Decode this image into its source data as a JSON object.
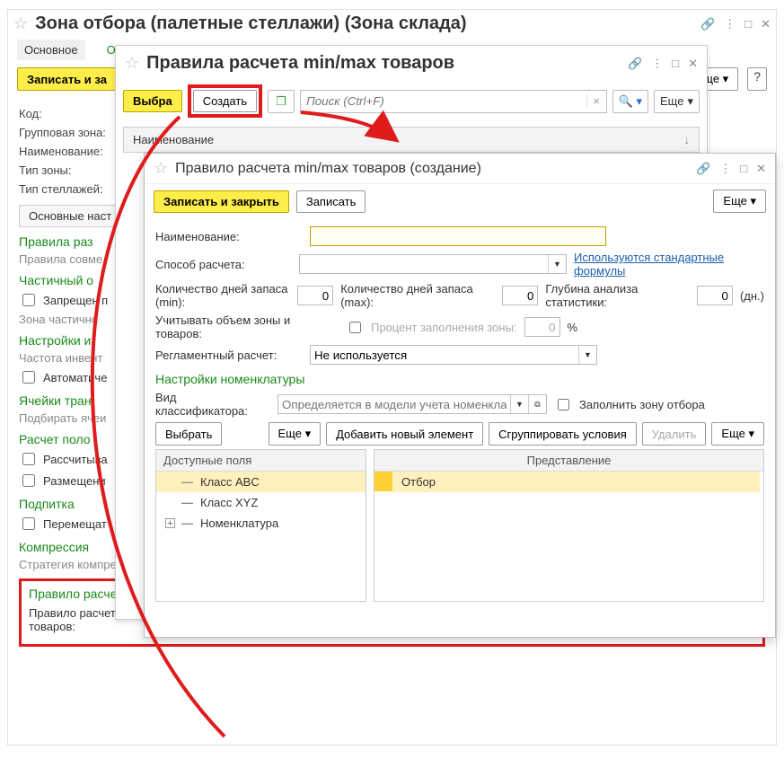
{
  "win1": {
    "title": "Зона отбора (палетные стеллажи) (Зона склада)",
    "tabs": {
      "main": "Основное",
      "other": "Ос"
    },
    "toolbar": {
      "save_close": "Записать и за",
      "more_tail": "ще",
      "help": "?"
    },
    "labels": {
      "code": "Код:",
      "group_zone": "Групповая зона:",
      "name": "Наименование:",
      "zone_type": "Тип зоны:",
      "rack_type": "Тип стеллажей:"
    },
    "settings_tab": "Основные наст",
    "sections": {
      "placement_rules": "Правила раз",
      "compat_rules": "Правила совме",
      "partial": "Частичный о",
      "partial_block": "Запрещен п",
      "partial_zone": "Зона частично",
      "inv_settings": "Настройки и",
      "inv_freq": "Частота инвент",
      "auto": "Автоматиче",
      "transit_cells": "Ячейки тран",
      "pick_cells": "Подбирать ячеи",
      "calc_pos": "Расчет поло",
      "calc_chk": "Рассчитыва",
      "place_chk": "Размещени",
      "feed": "Подпитка",
      "move_chk": "Перемещат",
      "compress": "Компрессия",
      "compress_strategy": "Стратегия компресси"
    },
    "highlight": {
      "heading": "Правило расчета min/max товаров",
      "field_label": "Правило расчета min/max товаров:"
    }
  },
  "win2": {
    "title": "Правила расчета min/max товаров",
    "buttons": {
      "select": "Выбра",
      "create": "Создать"
    },
    "search_ph": "Поиск (Ctrl+F)",
    "more": "Еще",
    "list_header": "Наименование"
  },
  "win3": {
    "title": "Правило расчета min/max товаров (создание)",
    "buttons": {
      "save_close": "Записать и закрыть",
      "save": "Записать",
      "more": "Еще",
      "select": "Выбрать",
      "add_elem": "Добавить новый элемент",
      "group": "Сгруппировать условия",
      "delete": "Удалить"
    },
    "labels": {
      "name": "Наименование:",
      "method": "Способ расчета:",
      "days_min": "Количество дней запаса (min):",
      "days_max": "Количество дней запаса (max):",
      "stat_depth": "Глубина анализа статистики:",
      "days_unit": "(дн.)",
      "consider_vol": "Учитывать объем зоны и товаров:",
      "fill_pct": "Процент заполнения зоны:",
      "pct": "%",
      "reg_calc": "Регламентный расчет:",
      "classifier": "Вид классификатора:",
      "classifier_ph": "Определяется в модели учета номенклатуры",
      "fill_zone_chk": "Заполнить зону отбора"
    },
    "values": {
      "days_min": "0",
      "days_max": "0",
      "stat_depth": "0",
      "fill_pct": "0",
      "reg_calc": "Не используется"
    },
    "link_std": "Используются стандартные формулы",
    "section_nomen": "Настройки номенклатуры",
    "panels": {
      "left_head": "Доступные поля",
      "right_head": "Представление",
      "items": {
        "abc": "Класс ABC",
        "xyz": "Класс XYZ",
        "nomen": "Номенклатура"
      },
      "repr": "Отбор"
    }
  }
}
